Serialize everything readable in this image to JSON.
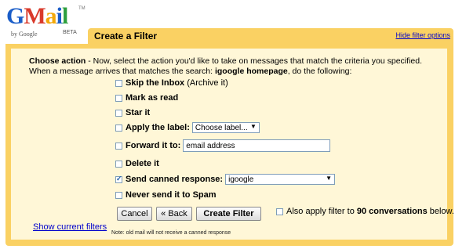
{
  "logo": {
    "word": "Gmail",
    "by": "by Google",
    "beta": "BETA",
    "tm": "TM"
  },
  "header": {
    "title": "Create a Filter",
    "hide_link": "Hide filter options"
  },
  "description": {
    "label": "Choose action",
    "text1": " - Now, select the action you'd like to take on messages that match the criteria you specified.",
    "text2": "When a message arrives that matches the search: ",
    "search_term": "igoogle homepage",
    "text3": ", do the following:"
  },
  "options": {
    "skip_inbox": {
      "label": "Skip the Inbox",
      "note": "(Archive it)",
      "checked": false
    },
    "mark_read": {
      "label": "Mark as read",
      "checked": false
    },
    "star": {
      "label": "Star it",
      "checked": false
    },
    "apply_label": {
      "label": "Apply the label:",
      "select_value": "Choose label...",
      "checked": false
    },
    "forward": {
      "label": "Forward it to:",
      "input_value": "email address",
      "checked": false
    },
    "delete": {
      "label": "Delete it",
      "checked": false
    },
    "canned": {
      "label": "Send canned response:",
      "select_value": "igoogle",
      "checked": true
    },
    "never_spam": {
      "label": "Never send it to Spam",
      "checked": false
    }
  },
  "buttons": {
    "cancel": "Cancel",
    "back": "« Back",
    "create": "Create Filter"
  },
  "also_apply": {
    "before": "Also apply filter to",
    "count": "90 conversations",
    "after": "below."
  },
  "show_filters_link": "Show current filters",
  "note": "Note: old mail will not receive a canned response",
  "colors": {
    "frame": "#fad163",
    "panel_bg": "#fff7d7",
    "link": "#0000cc"
  }
}
